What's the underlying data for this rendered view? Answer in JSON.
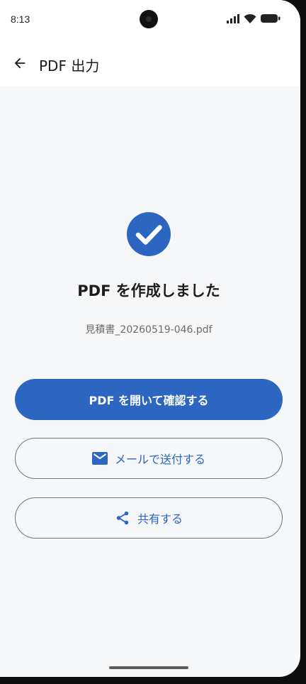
{
  "status_bar": {
    "time": "8:13"
  },
  "app_bar": {
    "title": "PDF 出力"
  },
  "result": {
    "headline": "PDF を作成しました",
    "filename": "見積書_20260519-046.pdf"
  },
  "actions": {
    "open_label": "PDF を開いて確認する",
    "mail_label": "メールで送付する",
    "share_label": "共有する"
  },
  "colors": {
    "accent": "#2d66c0",
    "background": "#f6f7f9"
  },
  "icons": {
    "back": "arrow-left-icon",
    "success": "check-circle-icon",
    "mail": "mail-icon",
    "share": "share-icon"
  }
}
